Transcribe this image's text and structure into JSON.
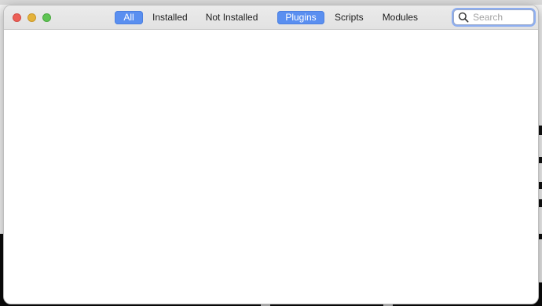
{
  "window": {
    "traffic_lights": {
      "close_color": "#ec5f57",
      "minimize_color": "#e4b23a",
      "zoom_color": "#5fc454"
    }
  },
  "toolbar": {
    "status_filters": [
      {
        "label": "All",
        "active": true
      },
      {
        "label": "Installed",
        "active": false
      },
      {
        "label": "Not Installed",
        "active": false
      }
    ],
    "type_filters": [
      {
        "label": "Plugins",
        "active": true
      },
      {
        "label": "Scripts",
        "active": false
      },
      {
        "label": "Modules",
        "active": false
      }
    ],
    "search": {
      "placeholder": "Search",
      "value": "",
      "icon": "magnifying-glass-icon"
    },
    "accent_color": "#5a8ff0"
  },
  "content": {
    "items": []
  }
}
